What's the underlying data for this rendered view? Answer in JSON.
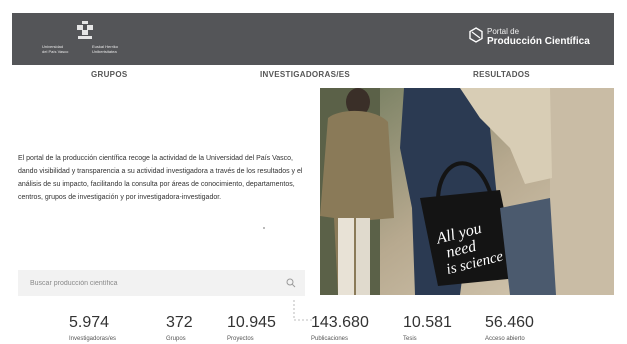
{
  "header": {
    "university_line1": "Universidad",
    "university_line2": "del País Vasco",
    "basque_line1": "Euskal Herriko",
    "basque_line2": "Unibertsitatea",
    "portal_line1": "Portal de",
    "portal_line2": "Producción Científica"
  },
  "nav": [
    {
      "label": "GRUPOS"
    },
    {
      "label": "INVESTIGADORAS/ES"
    },
    {
      "label": "RESULTADOS"
    }
  ],
  "intro_text": "El portal de la producción científica recoge la actividad de la Universidad del País Vasco, dando visibilidad y transparencia a su actividad investigadora a través de los resultados y el análisis de su impacto, facilitando la consulta por áreas de conocimiento, departamentos, centros, grupos de investigación y por investigadora-investigador.",
  "hero_bag_text": [
    "All you",
    "need",
    "is science"
  ],
  "search": {
    "placeholder": "Buscar producción científica"
  },
  "stats": [
    {
      "value": "5.974",
      "label": "Investigadoras/es"
    },
    {
      "value": "372",
      "label": "Grupos"
    },
    {
      "value": "10.945",
      "label": "Proyectos"
    },
    {
      "value": "143.680",
      "label": "Publicaciones"
    },
    {
      "value": "10.581",
      "label": "Tesis"
    },
    {
      "value": "56.460",
      "label": "Acceso abierto"
    }
  ],
  "colors": {
    "header_bg": "#545558",
    "search_bg": "#f2f2f2",
    "text": "#333333"
  }
}
